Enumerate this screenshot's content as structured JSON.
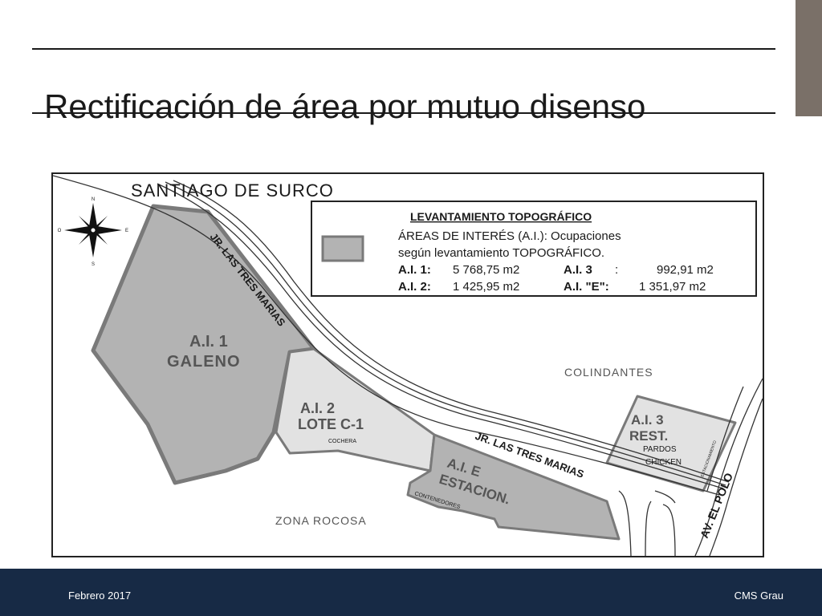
{
  "slide": {
    "title": "Rectificación de área por mutuo disenso"
  },
  "map": {
    "district_label": "SANTIAGO DE SURCO",
    "compass": {
      "n": "N",
      "s": "S",
      "e": "E",
      "o": "O"
    },
    "street_upper": "JR. LAS TRES MARIAS",
    "street_lower": "JR. LAS TRES MARIAS",
    "avenue": "AV. EL POLO",
    "legend": {
      "title": "LEVANTAMIENTO TOPOGRÁFICO",
      "line1": "ÁREAS DE INTERÉS (A.I.): Ocupaciones",
      "line2": "según levantamiento TOPOGRÁFICO.",
      "ai1_label": "A.I. 1:",
      "ai1_value": "5 768,75 m2",
      "ai2_label": "A.I. 2:",
      "ai2_value": "1 425,95 m2",
      "ai3_label": "A.I. 3",
      "ai3_sep": ":",
      "ai3_value": "992,91 m2",
      "aie_label": "A.I. \"E\":",
      "aie_value": "1 351,97 m2"
    },
    "areas": {
      "ai1_name": "A.I. 1",
      "ai1_sub": "GALENO",
      "ai2_name": "A.I. 2",
      "ai2_sub": "LOTE C-1",
      "ai2_detail": "COCHERA",
      "aie_name": "A.I. E",
      "aie_sub": "ESTACION.",
      "aie_detail": "CONTENEDORES",
      "ai3_name": "A.I. 3",
      "ai3_sub": "REST.",
      "ai3_detail1": "PARDOS",
      "ai3_detail2": "CHICKEN",
      "ai3_side": "ESTACIONAMIENTO"
    },
    "labels": {
      "colindantes": "COLINDANTES",
      "zona_rocosa": "ZONA ROCOSA"
    },
    "colors": {
      "area_fill_dark": "#b3b3b3",
      "area_fill_light": "#e2e2e2",
      "area_stroke": "#7a7a7a"
    }
  },
  "footer": {
    "date": "Febrero 2017",
    "company": "CMS Grau"
  }
}
